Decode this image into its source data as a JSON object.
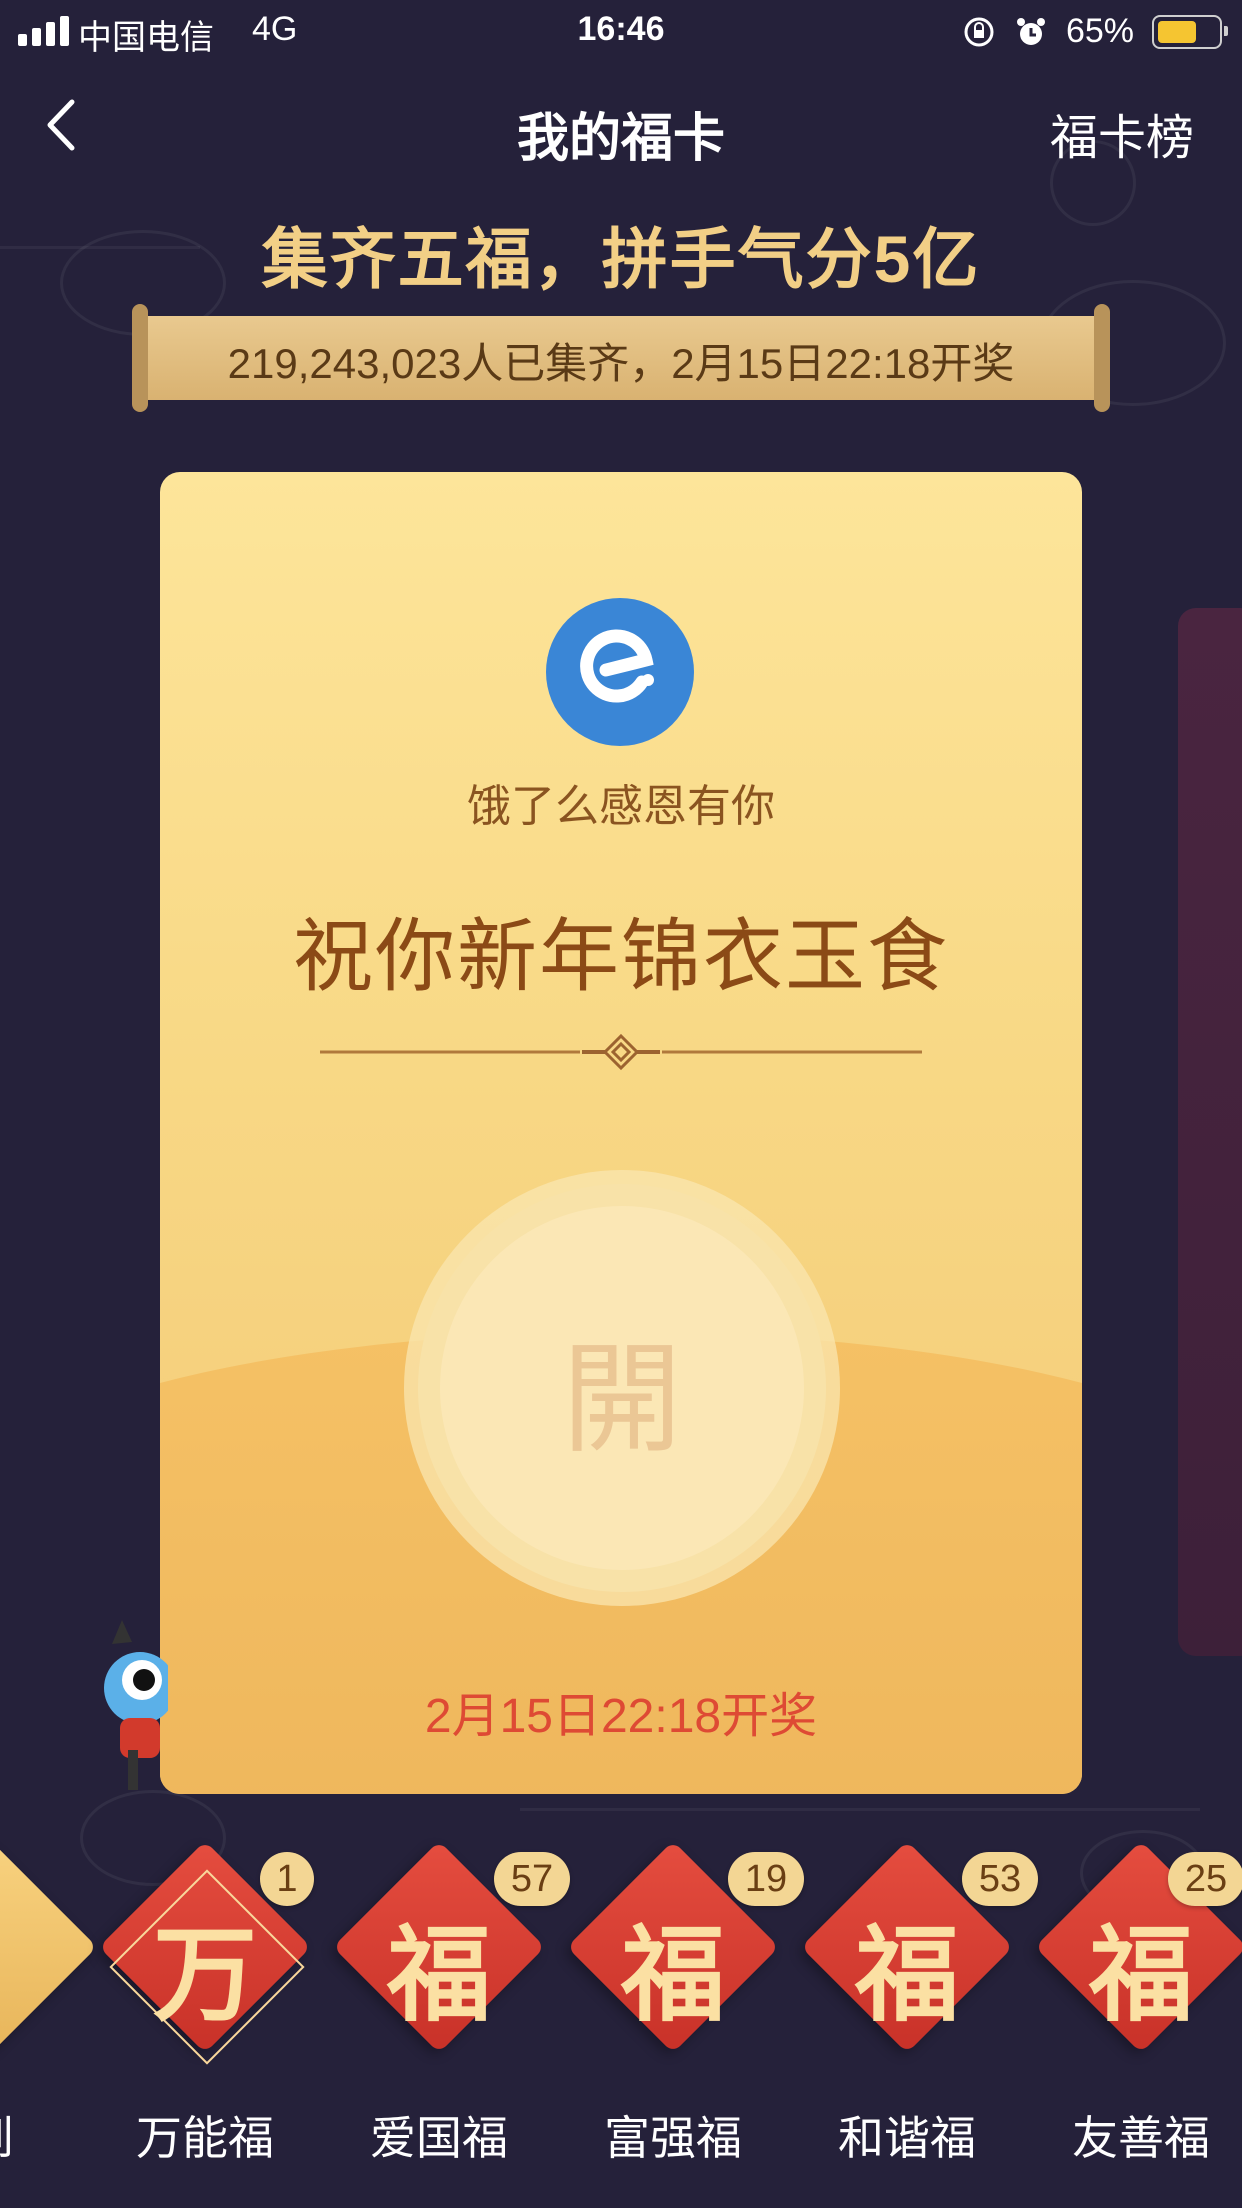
{
  "status_bar": {
    "carrier": "中国电信",
    "network": "4G",
    "time": "16:46",
    "battery": "65%",
    "battery_level": 0.65,
    "icons": [
      "signal-icon",
      "orientation-lock-icon",
      "alarm-icon",
      "battery-icon"
    ]
  },
  "nav": {
    "back_icon": "chevron-left-icon",
    "title": "我的福卡",
    "right_link": "福卡榜"
  },
  "headline": {
    "title": "集齐五福，拼手气分5亿",
    "scroll_text": "219,243,023人已集齐，2月15日22:18开奖"
  },
  "card": {
    "brand_icon": "eleme-logo-icon",
    "brand_name": "饿了么感恩有你",
    "blessing": "祝你新年锦衣玉食",
    "open_char": "開",
    "draw_date": "2月15日22:18开奖"
  },
  "fu_cards": [
    {
      "label": "到",
      "char": "",
      "count": null
    },
    {
      "label": "万能福",
      "char": "万",
      "count": "1"
    },
    {
      "label": "爱国福",
      "char": "福",
      "count": "57"
    },
    {
      "label": "富强福",
      "char": "福",
      "count": "19"
    },
    {
      "label": "和谐福",
      "char": "福",
      "count": "53"
    },
    {
      "label": "友善福",
      "char": "福",
      "count": "25"
    }
  ],
  "colors": {
    "background": "#25213a",
    "headline_gold": "#f2cf86",
    "card_yellow": "#fde59a",
    "fu_red": "#d63b30",
    "date_red": "#de4a34"
  }
}
